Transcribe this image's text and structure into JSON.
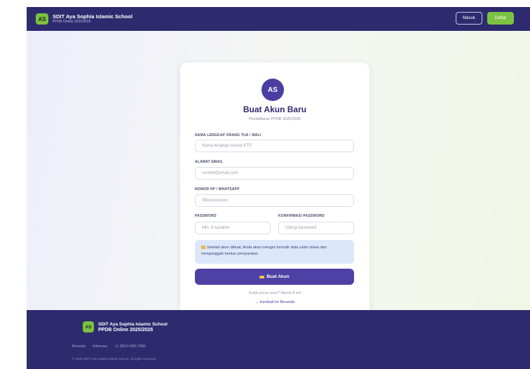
{
  "nav": {
    "logo": "AS",
    "title": "SDIT Aya Sophia Islamic School",
    "subtitle": "PPDB Online 2025/2026",
    "login_button": "Masuk",
    "register_button": "Daftar"
  },
  "card": {
    "avatar": "AS",
    "title": "Buat Akun Baru",
    "subtitle": "Pendaftaran PPDB 2025/2026",
    "fields": {
      "name": {
        "label": "NAMA LENGKAP ORANG TUA / WALI",
        "placeholder": "Nama lengkap sesuai KTP"
      },
      "email": {
        "label": "ALAMAT EMAIL",
        "placeholder": "contoh@email.com"
      },
      "phone": {
        "label": "NOMOR HP / WHATSAPP",
        "placeholder": "08xxxxxxxxxx"
      },
      "password": {
        "label": "PASSWORD",
        "placeholder": "Min. 6 karakter"
      },
      "confirm": {
        "label": "KONFIRMASI PASSWORD",
        "placeholder": "Ulangi password"
      }
    },
    "info": "Setelah akun dibuat, Anda akan mengisi formulir data calon siswa dan mengunggah berkas persyaratan.",
    "submit": "Buat Akun",
    "login_prompt": "Sudah punya akun? Masuk di sini",
    "back_link": "← Kembali ke Beranda"
  },
  "footer": {
    "logo": "AS",
    "title": "SDIT Aya Sophia Islamic School",
    "subtitle": "PPDB Online 2025/2026",
    "links": [
      "Beranda",
      "Informasi",
      "☏ 0812-3456-7890"
    ],
    "copyright": "© 2026 SDIT Aya Sophia Islamic School. All rights reserved."
  },
  "colors": {
    "nav_bg": "#2e2a6e",
    "accent_green": "#7cc242",
    "primary": "#4e41a5",
    "info_bg": "#dce8fa"
  }
}
